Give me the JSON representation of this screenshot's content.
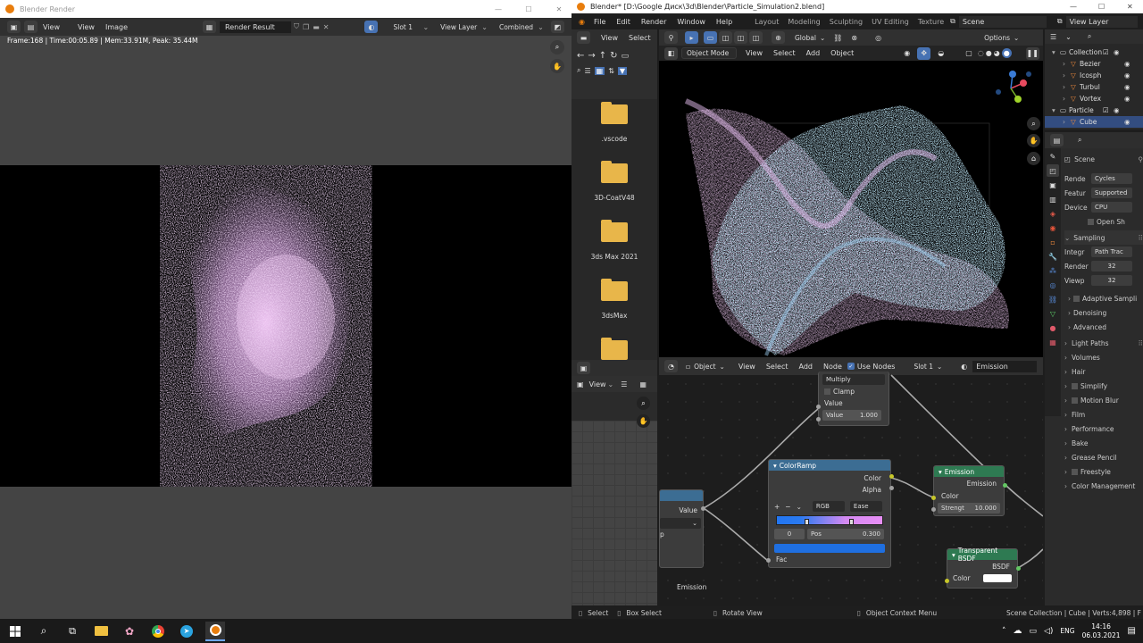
{
  "render_window": {
    "title": "Blender Render",
    "menu": [
      "View",
      "View",
      "Image"
    ],
    "image_name": "Render Result",
    "slot": "Slot 1",
    "view_layer": "View Layer",
    "pass": "Combined",
    "status": "Frame:168 | Time:00:05.89 | Mem:33.91M, Peak: 35.44M"
  },
  "main_window": {
    "title": "Blender* [D:\\Google Диск\\3d\\Blender\\Particle_Simulation2.blend]",
    "menu": [
      "File",
      "Edit",
      "Render",
      "Window",
      "Help"
    ],
    "workspaces": [
      "Layout",
      "Modeling",
      "Sculpting",
      "UV Editing",
      "Texture"
    ],
    "scene": "Scene",
    "view_layer": "View Layer"
  },
  "file_browser": {
    "menu": [
      "View",
      "Select"
    ],
    "folders": [
      ".vscode",
      "3D-CoatV48",
      "3ds Max 2021",
      "3dsMax",
      ""
    ]
  },
  "viewport": {
    "mode": "Object Mode",
    "menu": [
      "View",
      "Select",
      "Add",
      "Object"
    ],
    "orientation": "Global",
    "options": "Options"
  },
  "outliner": {
    "items": [
      {
        "label": "Collection",
        "level": 0,
        "type": "collection"
      },
      {
        "label": "Bezier",
        "level": 1,
        "type": "object"
      },
      {
        "label": "Icosph",
        "level": 1,
        "type": "object"
      },
      {
        "label": "Turbul",
        "level": 1,
        "type": "object"
      },
      {
        "label": "Vortex",
        "level": 1,
        "type": "object"
      },
      {
        "label": "Particle",
        "level": 0,
        "type": "collection"
      },
      {
        "label": "Cube",
        "level": 1,
        "type": "object",
        "selected": true
      }
    ]
  },
  "properties": {
    "scene_name": "Scene",
    "render_engine_label": "Rende",
    "render_engine": "Cycles",
    "feature_label": "Featur",
    "feature_set": "Supported",
    "device_label": "Device",
    "device": "CPU",
    "open_shading": "Open Sh",
    "sampling_label": "Sampling",
    "integrator_label": "Integr",
    "integrator": "Path Trac",
    "render_label": "Render",
    "render_samples": "32",
    "viewport_label": "Viewp",
    "viewport_samples": "32",
    "sub_panels": [
      "Adaptive Sampli",
      "Denoising",
      "Advanced"
    ],
    "panels": [
      {
        "label": "Light Paths",
        "checkbox": false
      },
      {
        "label": "Volumes",
        "checkbox": false
      },
      {
        "label": "Hair",
        "checkbox": false
      },
      {
        "label": "Simplify",
        "checkbox": true
      },
      {
        "label": "Motion Blur",
        "checkbox": true
      },
      {
        "label": "Film",
        "checkbox": false
      },
      {
        "label": "Performance",
        "checkbox": false
      },
      {
        "label": "Bake",
        "checkbox": false
      },
      {
        "label": "Grease Pencil",
        "checkbox": false
      },
      {
        "label": "Freestyle",
        "checkbox": true
      },
      {
        "label": "Color Management",
        "checkbox": false
      }
    ]
  },
  "image_editor": {
    "menu": "View"
  },
  "node_editor": {
    "type": "Object",
    "menu": [
      "View",
      "Select",
      "Add",
      "Node"
    ],
    "use_nodes": "Use Nodes",
    "slot": "Slot 1",
    "material": "Emission",
    "material_label": "Emission",
    "math_node": {
      "operation": "Multiply",
      "clamp": "Clamp",
      "input_label": "Value",
      "value_label": "Value",
      "value": "1.000"
    },
    "left_node": {
      "output": "Value",
      "partial": "p"
    },
    "colorramp": {
      "title": "ColorRamp",
      "out_color": "Color",
      "out_alpha": "Alpha",
      "mode": "RGB",
      "interp": "Ease",
      "index": "0",
      "pos_label": "Pos",
      "pos": "0.300",
      "input": "Fac",
      "plus": "+",
      "minus": "−"
    },
    "emission": {
      "title": "Emission",
      "output": "Emission",
      "color": "Color",
      "strength_label": "Strengt",
      "strength": "10.000"
    },
    "transparent": {
      "title": "Transparent BSDF",
      "output": "BSDF",
      "color": "Color"
    }
  },
  "status_bar": {
    "select": "Select",
    "box_select": "Box Select",
    "rotate": "Rotate View",
    "context_menu": "Object Context Menu",
    "info": "Scene Collection | Cube | Verts:4,898 | F"
  },
  "taskbar": {
    "lang": "ENG",
    "time": "14:16",
    "date": "06.03.2021"
  },
  "colors": {
    "blender_orange": "#e87d0d",
    "node_colorramp": "#3c6d93",
    "node_emission": "#2e7a52",
    "selection_blue": "#334d80"
  }
}
